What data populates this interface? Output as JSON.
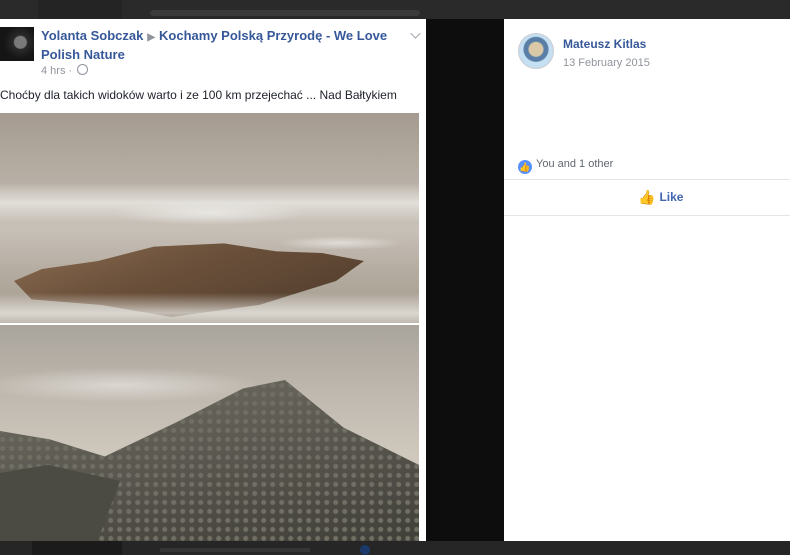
{
  "post": {
    "author": "Yolanta Sobczak",
    "group": "Kochamy Polską Przyrodę - We Love Polish Nature",
    "time": "4 hrs",
    "meta_sep": "·",
    "text": "Choćby dla takich widoków warto i ze 100 km przejechać ... Nad Bałtykiem"
  },
  "viewer": {
    "name": "Mateusz Kitlas",
    "date": "13 February 2015",
    "reactions_text": "You and 1 other",
    "like_label": "Like"
  },
  "colors": {
    "link": "#365899",
    "like_blue": "#4267b2",
    "reaction_blue": "#5890ff"
  },
  "icons": [
    "avatar",
    "chevron-down-icon",
    "globe-icon",
    "like-reaction-icon",
    "thumbs-up-icon"
  ]
}
